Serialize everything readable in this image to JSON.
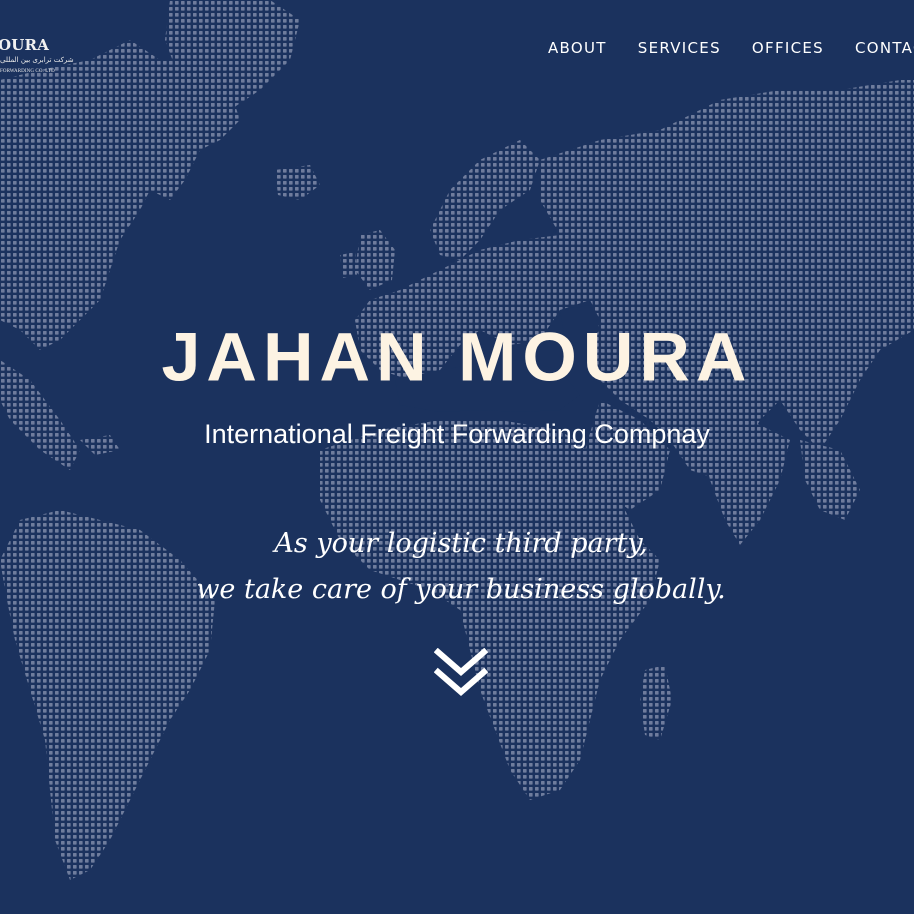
{
  "brand": {
    "logo_text": "JAHAN MOURA",
    "logo_visible_text": "OURA",
    "logo_persian": "شرکت ترابری بین المللی",
    "logo_sub": "FORWARDING CO. LTD"
  },
  "nav": {
    "items": [
      {
        "label": "ABOUT"
      },
      {
        "label": "SERVICES"
      },
      {
        "label": "OFFICES"
      },
      {
        "label": "CONTACT"
      }
    ]
  },
  "hero": {
    "title": "JAHAN MOURA",
    "subtitle": "International Freight Forwarding Compnay",
    "tagline_line1": "As your logistic third party,",
    "tagline_line2": "we take care of your business globally."
  },
  "icons": {
    "scroll": "double-chevron-down-icon",
    "background": "dotted-world-map"
  },
  "colors": {
    "background": "#1b325e",
    "map_dots": "#7e8aa8",
    "title": "#fdf3e3",
    "text": "#ffffff"
  }
}
